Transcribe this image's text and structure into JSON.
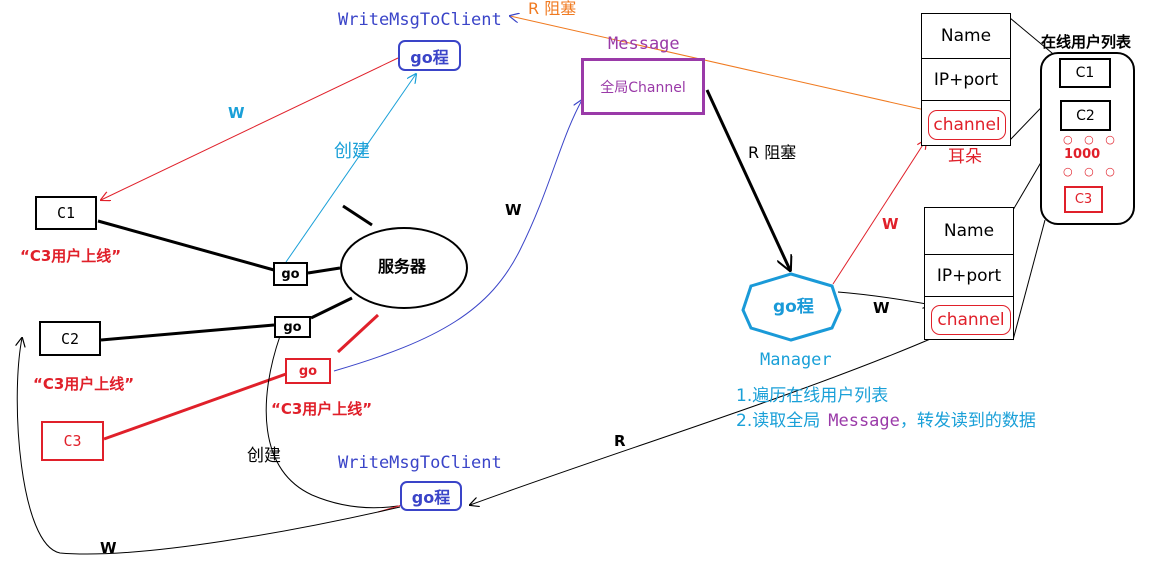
{
  "clients": {
    "c1": "C1",
    "c2": "C2",
    "c3": "C3"
  },
  "online_msg": "“C3用户上线”",
  "server": "服务器",
  "go": "go",
  "go_cheng": "go程",
  "write_msg_to_client": "WriteMsgToClient",
  "create": "创建",
  "w": "W",
  "r": "R",
  "r_blocked": "R 阻塞",
  "message": "Message",
  "global_channel": "全局Channel",
  "manager": "Manager",
  "user_table": {
    "name": "Name",
    "ip_port": "IP+port",
    "channel": "channel"
  },
  "ear": "耳朵",
  "online_list": {
    "title": "在线用户列表",
    "items": [
      "C1",
      "C2"
    ],
    "dots": "○ ○ ○",
    "count": "1000",
    "last": "C3"
  },
  "manager_steps": [
    "1.遍历在线用户列表",
    "2.读取全局"
  ],
  "step2_message": "Message",
  "step2_rest": "，转发读到的数据",
  "colors": {
    "black": "#000000",
    "red": "#e0202a",
    "blue": "#3a44c8",
    "cyan": "#1aa0d8",
    "purple": "#9a3aa8",
    "orange": "#f07a20",
    "hexagon": "#1a9ad8"
  }
}
